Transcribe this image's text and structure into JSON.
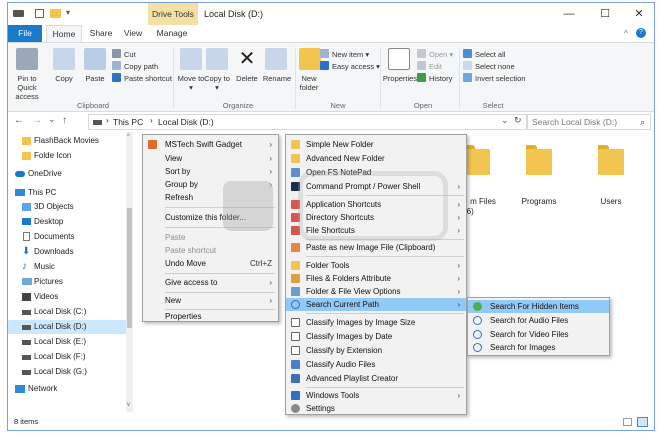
{
  "window": {
    "quick_access_icons": [
      "disk-icon",
      "checkbox-icon",
      "folder-icon"
    ],
    "context_tab": "Drive Tools",
    "title": "Local Disk (D:)",
    "controls": {
      "minimize": "—",
      "maximize": "☐",
      "close": "✕"
    }
  },
  "ribbon_tabs": [
    "File",
    "Home",
    "Share",
    "View",
    "Manage"
  ],
  "ribbon": {
    "clipboard": {
      "pin": "Pin to Quick access",
      "copy": "Copy",
      "paste": "Paste",
      "cut": "Cut",
      "copy_path": "Copy path",
      "paste_shortcut": "Paste shortcut",
      "group": "Clipboard"
    },
    "organize": {
      "move_to": "Move to ▾",
      "copy_to": "Copy to ▾",
      "delete": "Delete",
      "rename": "Rename",
      "group": "Organize"
    },
    "new": {
      "new_folder": "New folder",
      "new_item": "New item ▾",
      "easy_access": "Easy access ▾",
      "group": "New"
    },
    "open": {
      "properties": "Properties",
      "open": "Open ▾",
      "edit": "Edit",
      "history": "History",
      "group": "Open"
    },
    "select": {
      "select_all": "Select all",
      "select_none": "Select none",
      "invert": "Invert selection",
      "group": "Select"
    }
  },
  "address": {
    "back": "←",
    "forward": "→",
    "recent": "⌄",
    "up": "↑",
    "path": [
      "This PC",
      "Local Disk (D:)"
    ],
    "search_placeholder": "Search Local Disk (D:)",
    "refresh": "↻",
    "dropdown": "⌄"
  },
  "nav": [
    {
      "label": "FlashBack Movies",
      "icon": "folder-icon"
    },
    {
      "label": "Folde Icon",
      "icon": "folder-icon"
    },
    {
      "label": "OneDrive",
      "icon": "cloud-icon"
    },
    {
      "label": "This PC",
      "icon": "computer-icon"
    },
    {
      "label": "3D Objects",
      "icon": "cube-icon"
    },
    {
      "label": "Desktop",
      "icon": "desktop-icon"
    },
    {
      "label": "Documents",
      "icon": "document-icon"
    },
    {
      "label": "Downloads",
      "icon": "download-icon"
    },
    {
      "label": "Music",
      "icon": "music-icon"
    },
    {
      "label": "Pictures",
      "icon": "picture-icon"
    },
    {
      "label": "Videos",
      "icon": "video-icon"
    },
    {
      "label": "Local Disk (C:)",
      "icon": "drive-icon"
    },
    {
      "label": "Local Disk (D:)",
      "icon": "drive-icon",
      "selected": true
    },
    {
      "label": "Local Disk (E:)",
      "icon": "drive-icon"
    },
    {
      "label": "Local Disk (F:)",
      "icon": "drive-icon"
    },
    {
      "label": "Local Disk (G:)",
      "icon": "drive-icon"
    },
    {
      "label": "Network",
      "icon": "network-icon"
    }
  ],
  "content": {
    "folders": [
      "m Files",
      "Programs",
      "Users"
    ],
    "partial_label": "36)"
  },
  "status": {
    "items": "8 items"
  },
  "context_menu": [
    {
      "label": "MSTech Swift Gadget",
      "arrow": true,
      "icon": "gadget-icon"
    },
    {
      "label": "View",
      "arrow": true
    },
    {
      "label": "Sort by",
      "arrow": true
    },
    {
      "label": "Group by",
      "arrow": true
    },
    {
      "label": "Refresh"
    },
    {
      "label": "Customize this folder..."
    },
    {
      "label": "Paste",
      "dim": true
    },
    {
      "label": "Paste shortcut",
      "dim": true
    },
    {
      "label": "Undo Move",
      "shortcut": "Ctrl+Z"
    },
    {
      "label": "Give access to",
      "arrow": true
    },
    {
      "label": "New",
      "arrow": true
    },
    {
      "label": "Properties"
    }
  ],
  "gadget_menu": [
    {
      "label": "Simple New Folder",
      "icon": "new-folder-icon"
    },
    {
      "label": "Advanced New Folder",
      "icon": "new-folder-icon"
    },
    {
      "label": "Open FS NotePad",
      "icon": "notepad-icon"
    },
    {
      "label": "Command Prompt / Power Shell",
      "arrow": true,
      "icon": "terminal-icon"
    },
    {
      "label": "Application Shortcuts",
      "arrow": true,
      "icon": "app-shortcut-icon"
    },
    {
      "label": "Directory Shortcuts",
      "arrow": true,
      "icon": "dir-shortcut-icon"
    },
    {
      "label": "File Shortcuts",
      "arrow": true,
      "icon": "file-shortcut-icon"
    },
    {
      "label": "Paste as new Image File (Clipboard)",
      "icon": "paste-image-icon"
    },
    {
      "label": "Folder Tools",
      "arrow": true,
      "icon": "folder-tools-icon"
    },
    {
      "label": "Files & Folders Attribute",
      "arrow": true,
      "icon": "attribute-icon"
    },
    {
      "label": "Folder & File View Options",
      "arrow": true,
      "icon": "view-options-icon"
    },
    {
      "label": "Search Current Path",
      "arrow": true,
      "icon": "search-icon",
      "highlight": true
    },
    {
      "label": "Classify Images by Image Size",
      "icon": "classify-icon"
    },
    {
      "label": "Classify Images by Date",
      "icon": "classify-icon"
    },
    {
      "label": "Classify by Extension",
      "icon": "classify-icon"
    },
    {
      "label": "Classify Audio Files",
      "icon": "classify-icon"
    },
    {
      "label": "Advanced Playlist Creator",
      "icon": "playlist-icon"
    },
    {
      "label": "Windows Tools",
      "arrow": true,
      "icon": "windows-tools-icon"
    },
    {
      "label": "Settings",
      "icon": "settings-icon"
    }
  ],
  "search_menu": [
    {
      "label": "Search For Hidden Items",
      "icon": "hidden-search-icon",
      "highlight": true
    },
    {
      "label": "Search for Audio Files",
      "icon": "search-icon"
    },
    {
      "label": "Search for Video Files",
      "icon": "search-icon"
    },
    {
      "label": "Search for Images",
      "icon": "search-icon"
    }
  ],
  "colors": {
    "accent": "#1979ca",
    "menu_highlight": "#91c9f7",
    "nav_selected": "#cce8ff",
    "folder": "#f1c550"
  }
}
